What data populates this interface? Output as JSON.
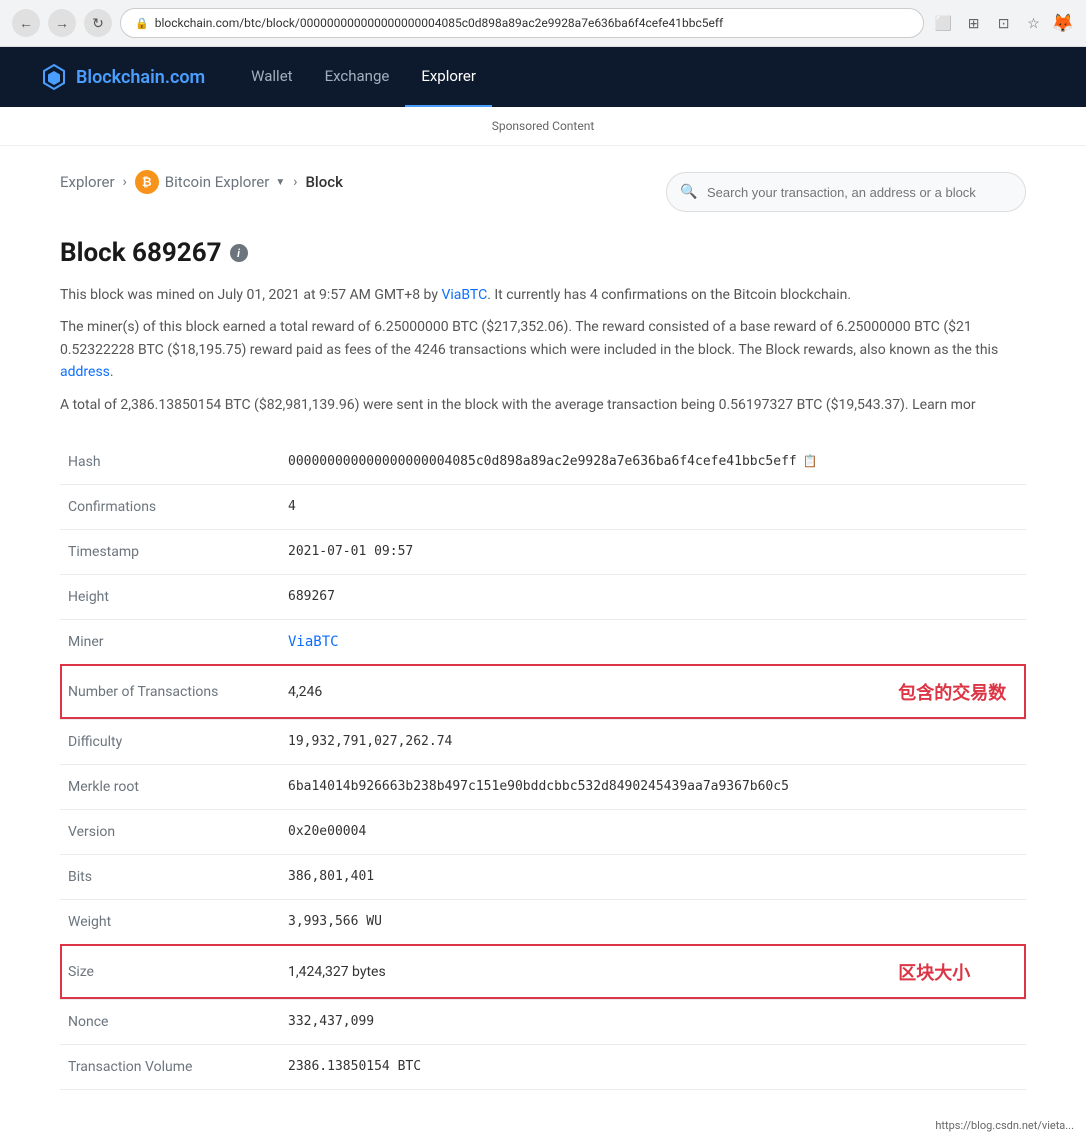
{
  "browser": {
    "url": "blockchain.com/btc/block/000000000000000000004085c0d898a89ac2e9928a7e636ba6f4cefe41bbc5eff",
    "favicon": "🦊"
  },
  "nav": {
    "logo_text": "Blockchain",
    "logo_dot": ".com",
    "links": [
      {
        "label": "Wallet",
        "active": false
      },
      {
        "label": "Exchange",
        "active": false
      },
      {
        "label": "Explorer",
        "active": true
      }
    ]
  },
  "sponsored": {
    "label": "Sponsored Content"
  },
  "breadcrumb": {
    "explorer": "Explorer",
    "bitcoin_explorer": "Bitcoin Explorer",
    "current": "Block"
  },
  "search": {
    "placeholder": "Search your transaction, an address or a block"
  },
  "page": {
    "title": "Block 689267",
    "desc1": "This block was mined on July 01, 2021 at 9:57 AM GMT+8 by ViaBTC. It currently has 4 confirmations on the Bitcoin blockchain.",
    "desc2": "The miner(s) of this block earned a total reward of 6.25000000 BTC ($217,352.06). The reward consisted of a base reward of 6.25000000 BTC ($21 0.52322228 BTC ($18,195.75) reward paid as fees of the 4246 transactions which were included in the block. The Block rewards, also known as the this address.",
    "desc3": "A total of 2,386.13850154 BTC ($82,981,139.96) were sent in the block with the average transaction being 0.56197327 BTC ($19,543.37).  Learn mor"
  },
  "table": {
    "rows": [
      {
        "key": "Hash",
        "value": "000000000000000000004085c0d898a89ac2e9928a7e636ba6f4cefe41bbc5eff",
        "copy": true,
        "highlight": false,
        "link": false,
        "annotation": ""
      },
      {
        "key": "Confirmations",
        "value": "4",
        "copy": false,
        "highlight": false,
        "link": false,
        "annotation": ""
      },
      {
        "key": "Timestamp",
        "value": "2021-07-01 09:57",
        "copy": false,
        "highlight": false,
        "link": false,
        "annotation": ""
      },
      {
        "key": "Height",
        "value": "689267",
        "copy": false,
        "highlight": false,
        "link": false,
        "annotation": ""
      },
      {
        "key": "Miner",
        "value": "ViaBTC",
        "copy": false,
        "highlight": false,
        "link": true,
        "annotation": ""
      },
      {
        "key": "Number of Transactions",
        "value": "4,246",
        "copy": false,
        "highlight": true,
        "link": false,
        "annotation": "包含的交易数"
      },
      {
        "key": "Difficulty",
        "value": "19,932,791,027,262.74",
        "copy": false,
        "highlight": false,
        "link": false,
        "annotation": ""
      },
      {
        "key": "Merkle root",
        "value": "6ba14014b926663b238b497c151e90bddcbbc532d8490245439aa7a9367b60c5",
        "copy": false,
        "highlight": false,
        "link": false,
        "annotation": ""
      },
      {
        "key": "Version",
        "value": "0x20e00004",
        "copy": false,
        "highlight": false,
        "link": false,
        "annotation": ""
      },
      {
        "key": "Bits",
        "value": "386,801,401",
        "copy": false,
        "highlight": false,
        "link": false,
        "annotation": ""
      },
      {
        "key": "Weight",
        "value": "3,993,566 WU",
        "copy": false,
        "highlight": false,
        "link": false,
        "annotation": ""
      },
      {
        "key": "Size",
        "value": "1,424,327 bytes",
        "copy": false,
        "highlight": true,
        "link": false,
        "annotation": "区块大小"
      },
      {
        "key": "Nonce",
        "value": "332,437,099",
        "copy": false,
        "highlight": false,
        "link": false,
        "annotation": ""
      },
      {
        "key": "Transaction Volume",
        "value": "2386.13850154 BTC",
        "copy": false,
        "highlight": false,
        "link": false,
        "annotation": ""
      }
    ]
  },
  "watermark": {
    "text": "https://blog.csdn.net/vieta..."
  }
}
